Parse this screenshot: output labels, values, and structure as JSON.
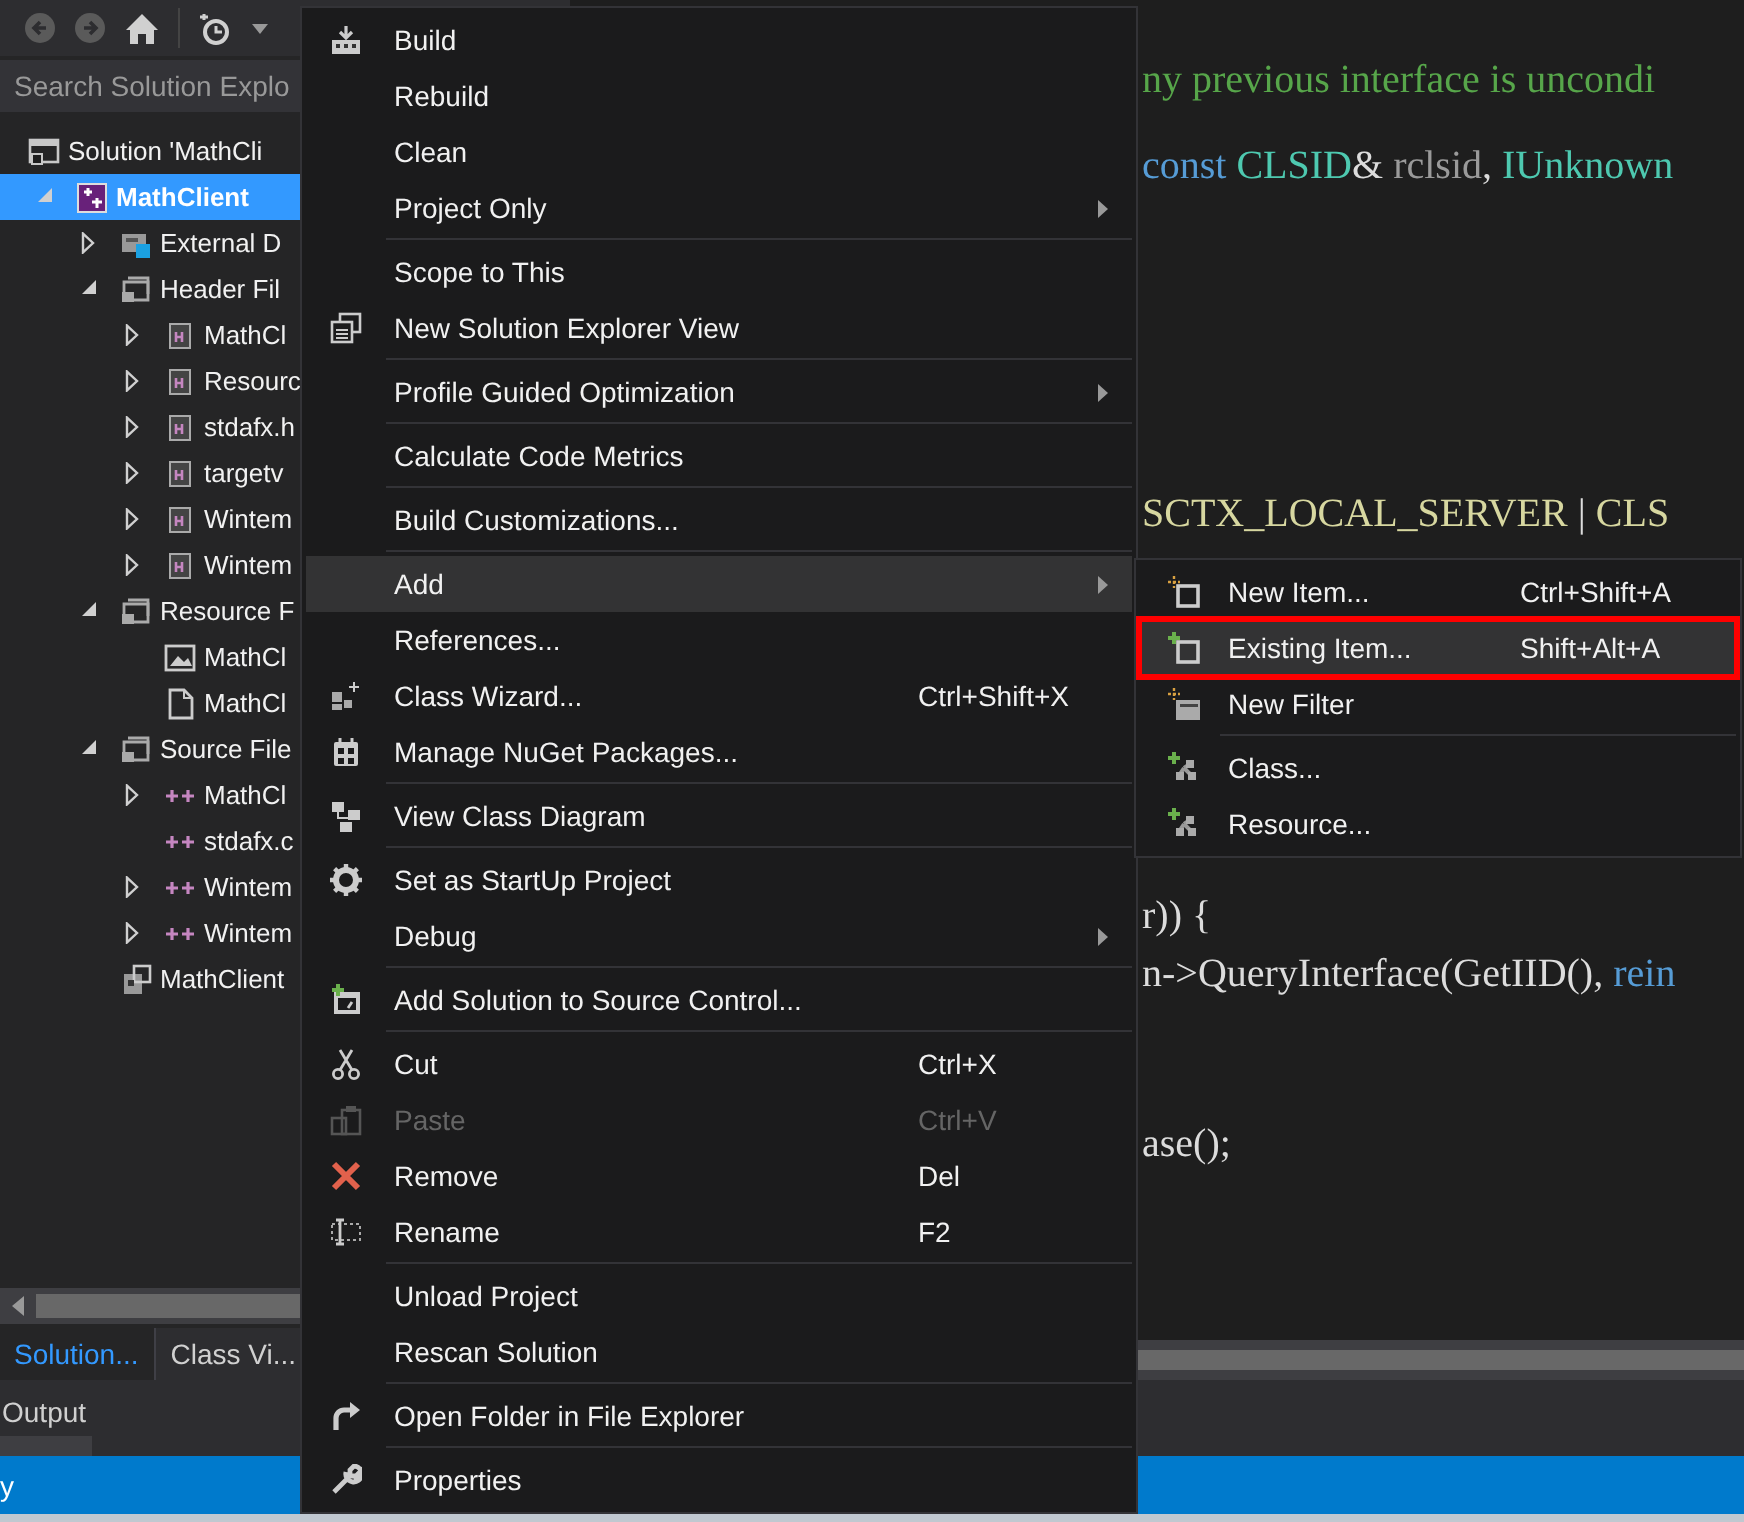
{
  "toolbar": {
    "back": {
      "disabled": true
    },
    "forward": {
      "disabled": true
    }
  },
  "search": {
    "placeholder": "Search Solution Explo"
  },
  "tree": [
    {
      "label": "Solution 'MathCli",
      "kind": "solution",
      "selected": false,
      "children": [
        {
          "label": "MathClient",
          "kind": "project",
          "selected": true,
          "expanded": true,
          "children": [
            {
              "label": "External D",
              "kind": "references",
              "selected": false,
              "expanded": false
            },
            {
              "label": "Header Fil",
              "kind": "folder",
              "selected": false,
              "expanded": true,
              "children": [
                {
                  "label": "MathCl",
                  "kind": "header",
                  "selected": false,
                  "expanded": false
                },
                {
                  "label": "Resourc",
                  "kind": "header",
                  "selected": false,
                  "expanded": false
                },
                {
                  "label": "stdafx.h",
                  "kind": "header",
                  "selected": false,
                  "expanded": false
                },
                {
                  "label": "targetv",
                  "kind": "header",
                  "selected": false,
                  "expanded": false
                },
                {
                  "label": "Wintem",
                  "kind": "header",
                  "selected": false,
                  "expanded": false
                },
                {
                  "label": "Wintem",
                  "kind": "header",
                  "selected": false,
                  "expanded": false
                }
              ]
            },
            {
              "label": "Resource F",
              "kind": "folder",
              "selected": false,
              "expanded": true,
              "children": [
                {
                  "label": "MathCl",
                  "kind": "image",
                  "selected": false
                },
                {
                  "label": "MathCl",
                  "kind": "document",
                  "selected": false
                }
              ]
            },
            {
              "label": "Source File",
              "kind": "folder",
              "selected": false,
              "expanded": true,
              "children": [
                {
                  "label": "MathCl",
                  "kind": "source",
                  "selected": false,
                  "expanded": false
                },
                {
                  "label": "stdafx.c",
                  "kind": "source",
                  "selected": false
                },
                {
                  "label": "Wintem",
                  "kind": "source",
                  "selected": false,
                  "expanded": false
                },
                {
                  "label": "Wintem",
                  "kind": "source",
                  "selected": false,
                  "expanded": false
                }
              ]
            },
            {
              "label": "MathClient",
              "kind": "resource",
              "selected": false
            }
          ]
        }
      ]
    }
  ],
  "panel_tabs": [
    {
      "label": "Solution...",
      "selected": true
    },
    {
      "label": "Class Vi...",
      "selected": false
    }
  ],
  "code_lines": [
    [
      {
        "kind": "comment",
        "text": "ny previous interface is uncondi"
      }
    ],
    [
      {
        "kind": "keyword",
        "text": "const "
      },
      {
        "kind": "type",
        "text": "CLSID"
      },
      {
        "kind": "plain",
        "text": "& "
      },
      {
        "kind": "param",
        "text": "rclsid"
      },
      {
        "kind": "plain",
        "text": ", "
      },
      {
        "kind": "type",
        "text": "IUnknown"
      }
    ],
    [
      {
        "kind": "macro",
        "text": "SCTX_LOCAL_SERVER"
      },
      {
        "kind": "plain",
        "text": " | "
      },
      {
        "kind": "macro",
        "text": "CLS"
      }
    ],
    [
      {
        "kind": "plain",
        "text": "r)) {"
      }
    ],
    [
      {
        "kind": "plain",
        "text": "n->QueryInterface(GetIID(), "
      },
      {
        "kind": "keyword",
        "text": "rein"
      }
    ],
    [
      {
        "kind": "plain",
        "text": "ase();"
      }
    ]
  ],
  "output_tab": {
    "label": "Output"
  },
  "status_bar": {
    "text": "y"
  },
  "menu": {
    "sections": [
      {
        "items": [
          {
            "label": "Build",
            "selected": false,
            "disabled": false,
            "submenu": false
          },
          {
            "label": "Rebuild",
            "selected": false,
            "disabled": false,
            "submenu": false
          },
          {
            "label": "Clean",
            "selected": false,
            "disabled": false,
            "submenu": false
          },
          {
            "label": "Project Only",
            "selected": false,
            "disabled": false,
            "submenu": true
          }
        ]
      },
      {
        "items": [
          {
            "label": "Scope to This",
            "selected": false,
            "disabled": false,
            "submenu": false
          },
          {
            "label": "New Solution Explorer View",
            "selected": false,
            "disabled": false,
            "submenu": false
          }
        ]
      },
      {
        "items": [
          {
            "label": "Profile Guided Optimization",
            "selected": false,
            "disabled": false,
            "submenu": true
          }
        ]
      },
      {
        "items": [
          {
            "label": "Calculate Code Metrics",
            "selected": false,
            "disabled": false,
            "submenu": false
          }
        ]
      },
      {
        "items": [
          {
            "label": "Build Customizations...",
            "selected": false,
            "disabled": false,
            "submenu": false
          }
        ]
      },
      {
        "items": [
          {
            "label": "Add",
            "selected": true,
            "disabled": false,
            "submenu": true
          },
          {
            "label": "References...",
            "selected": false,
            "disabled": false,
            "submenu": false
          },
          {
            "label": "Class Wizard...",
            "shortcut": "Ctrl+Shift+X",
            "selected": false,
            "disabled": false,
            "submenu": false
          },
          {
            "label": "Manage NuGet Packages...",
            "selected": false,
            "disabled": false,
            "submenu": false
          }
        ]
      },
      {
        "items": [
          {
            "label": "View Class Diagram",
            "selected": false,
            "disabled": false,
            "submenu": false
          }
        ]
      },
      {
        "items": [
          {
            "label": "Set as StartUp Project",
            "selected": false,
            "disabled": false,
            "submenu": false
          },
          {
            "label": "Debug",
            "selected": false,
            "disabled": false,
            "submenu": true
          }
        ]
      },
      {
        "items": [
          {
            "label": "Add Solution to Source Control...",
            "selected": false,
            "disabled": false,
            "submenu": false
          }
        ]
      },
      {
        "items": [
          {
            "label": "Cut",
            "shortcut": "Ctrl+X",
            "selected": false,
            "disabled": false,
            "submenu": false
          },
          {
            "label": "Paste",
            "shortcut": "Ctrl+V",
            "selected": false,
            "disabled": true,
            "submenu": false
          },
          {
            "label": "Remove",
            "shortcut": "Del",
            "selected": false,
            "disabled": false,
            "submenu": false
          },
          {
            "label": "Rename",
            "shortcut": "F2",
            "selected": false,
            "disabled": false,
            "submenu": false
          }
        ]
      },
      {
        "items": [
          {
            "label": "Unload Project",
            "selected": false,
            "disabled": false,
            "submenu": false
          },
          {
            "label": "Rescan Solution",
            "selected": false,
            "disabled": false,
            "submenu": false
          }
        ]
      },
      {
        "items": [
          {
            "label": "Open Folder in File Explorer",
            "selected": false,
            "disabled": false,
            "submenu": false
          }
        ]
      },
      {
        "items": [
          {
            "label": "Properties",
            "selected": false,
            "disabled": false,
            "submenu": false
          }
        ]
      }
    ]
  },
  "submenu": {
    "sections": [
      {
        "items": [
          {
            "label": "New Item...",
            "shortcut": "Ctrl+Shift+A",
            "selected": false,
            "highlighted": false
          },
          {
            "label": "Existing Item...",
            "shortcut": "Shift+Alt+A",
            "selected": true,
            "highlighted": true
          },
          {
            "label": "New Filter",
            "selected": false,
            "highlighted": false
          }
        ]
      },
      {
        "items": [
          {
            "label": "Class...",
            "selected": false,
            "highlighted": false
          },
          {
            "label": "Resource...",
            "selected": false,
            "highlighted": false
          }
        ]
      }
    ]
  }
}
